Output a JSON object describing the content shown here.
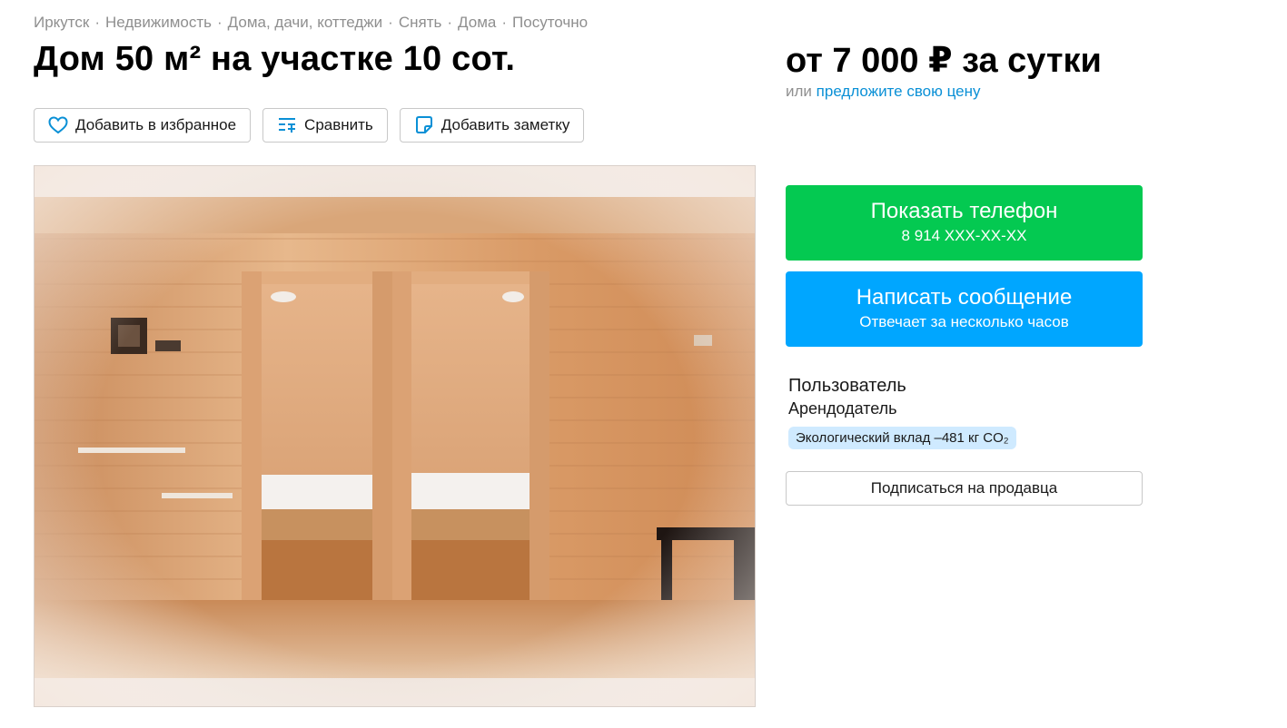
{
  "breadcrumbs": [
    "Иркутск",
    "Недвижимость",
    "Дома, дачи, коттеджи",
    "Снять",
    "Дома",
    "Посуточно"
  ],
  "breadcrumb_separator": "·",
  "title": "Дом 50 м² на участке 10 сот.",
  "actions": {
    "favorite_label": "Добавить в избранное",
    "compare_label": "Сравнить",
    "note_label": "Добавить заметку"
  },
  "gallery": {
    "image_description": "interior-wooden-room-photo"
  },
  "price": {
    "text": "от 7 000 ₽ за сутки",
    "offer_prefix": "или",
    "offer_link": "предложите свою цену"
  },
  "buttons": {
    "show_phone_label": "Показать телефон",
    "phone_masked": "8 914 XXX-XX-XX",
    "write_message_label": "Написать сообщение",
    "response_time": "Отвечает за несколько часов",
    "subscribe_label": "Подписаться на продавца"
  },
  "seller": {
    "name": "Пользователь",
    "role": "Арендодатель",
    "eco_badge": "Экологический вклад –481 кг CO₂"
  },
  "colors": {
    "phone_button": "#04c951",
    "message_button": "#00a6ff",
    "link": "#0a90d6",
    "icon_blue": "#0a90d6",
    "eco_badge_bg": "#cfeaff"
  }
}
